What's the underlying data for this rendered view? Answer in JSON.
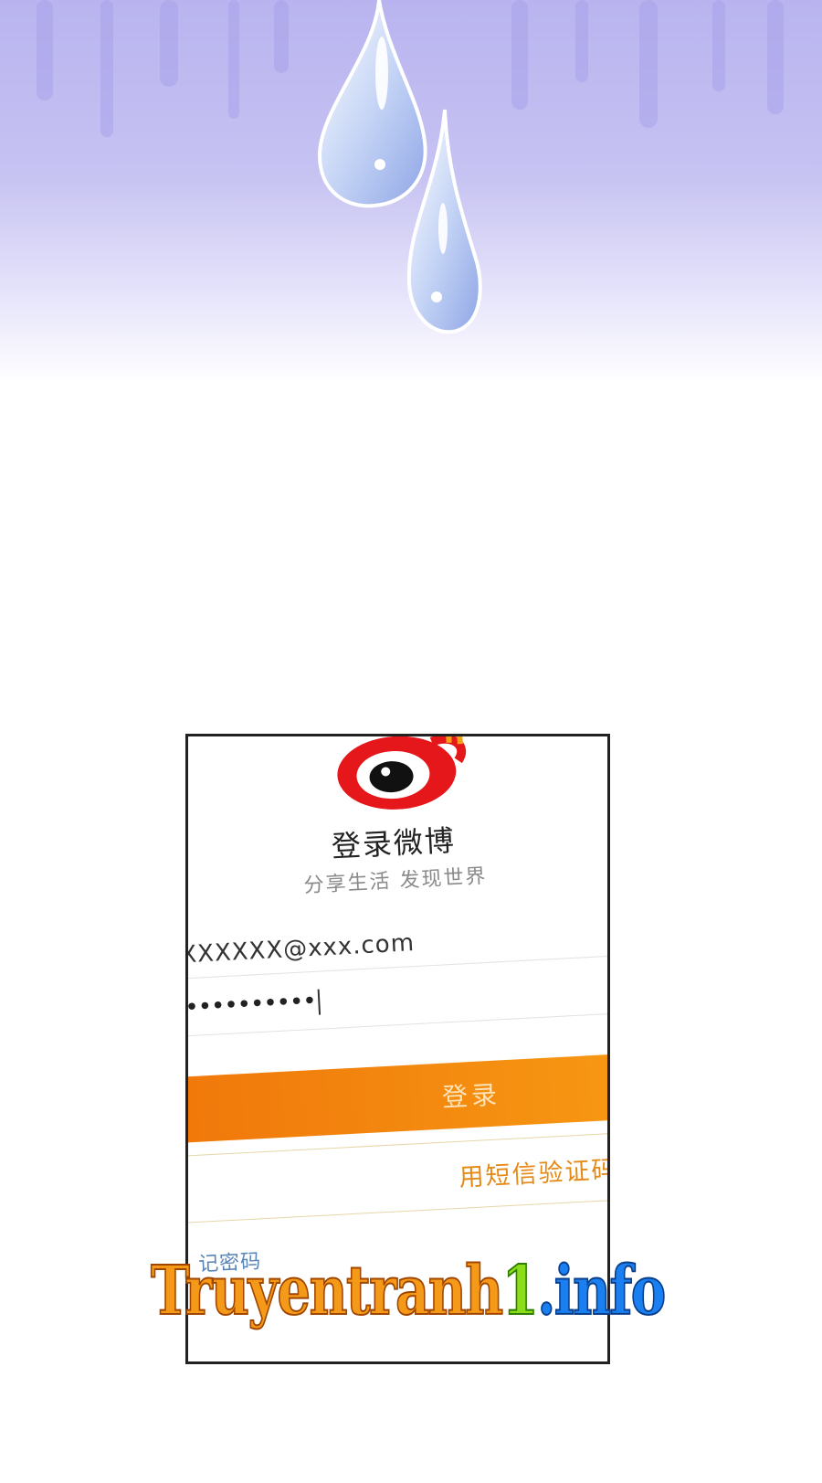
{
  "login_screen": {
    "title": "登录微博",
    "subtitle": "分享生活 发现世界",
    "email_value": "XXXXXX@xxx.com",
    "password_value": "••••••••••",
    "login_button": "登录",
    "sms_login_button": "用短信验证码登录",
    "forgot_password": "记密码"
  },
  "watermark": {
    "part1": "Truyentranh",
    "part2": "1",
    "part3": ".info"
  },
  "colors": {
    "sky": "#c6c2f2",
    "login_button": "#f58810",
    "sms_text": "#e58a16",
    "link": "#5b86b8",
    "logo_red": "#e5171b"
  },
  "icons": {
    "logo": "weibo-logo-icon",
    "drops": "water-drops-icon"
  }
}
